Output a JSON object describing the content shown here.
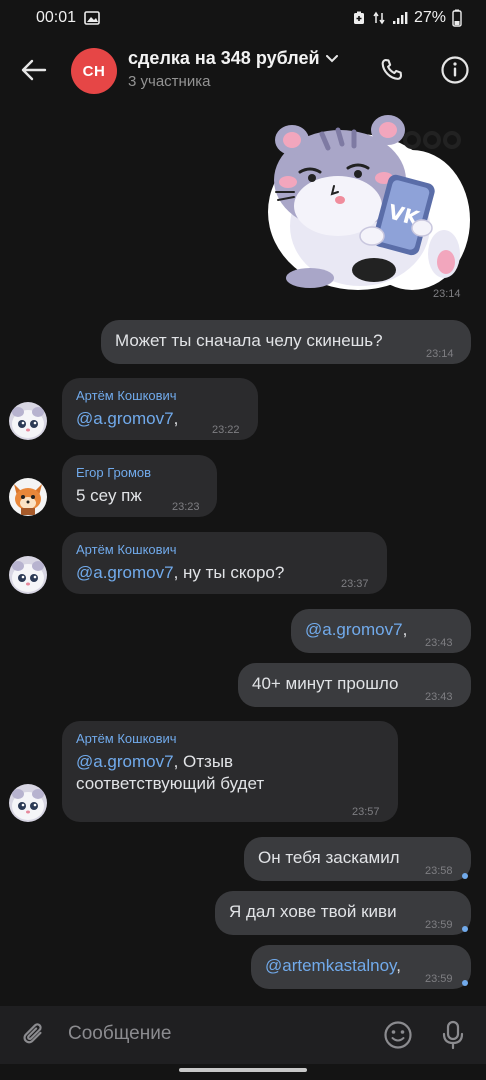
{
  "status_bar": {
    "time": "00:01",
    "battery": "27%"
  },
  "header": {
    "avatar_initials": "СН",
    "title": "сделка на 348 рублей",
    "subtitle": "3 участника",
    "colors": {
      "avatar": "#e64646",
      "accent": "#71aaeb"
    }
  },
  "sticker": {
    "time": "23:14"
  },
  "messages": [
    {
      "dir": "out",
      "text": "Может ты сначала челу скинешь?",
      "time": "23:14"
    },
    {
      "dir": "in",
      "sender": "Артём Кошкович",
      "mention": "@a.gromov7",
      "text": ",",
      "time": "23:22"
    },
    {
      "dir": "in",
      "sender": "Егор Громов",
      "text": "5 сеу пж",
      "time": "23:23"
    },
    {
      "dir": "in",
      "sender": "Артём Кошкович",
      "mention": "@a.gromov7",
      "text": ", ну ты скоро?",
      "time": "23:37"
    },
    {
      "dir": "out",
      "mention": "@a.gromov7",
      "text": ",",
      "time": "23:43"
    },
    {
      "dir": "out",
      "text": "40+ минут прошло",
      "time": "23:43"
    },
    {
      "dir": "in",
      "sender": "Артём Кошкович",
      "mention": "@a.gromov7",
      "text": ", Отзыв",
      "text2": "соответствующий будет",
      "time": "23:57"
    },
    {
      "dir": "out",
      "text": "Он тебя заскамил",
      "time": "23:58"
    },
    {
      "dir": "out",
      "text": "Я дал хове твой киви",
      "time": "23:59"
    },
    {
      "dir": "out",
      "mention": "@artemkastalnoy",
      "text": ",",
      "time": "23:59"
    }
  ],
  "composer": {
    "placeholder": "Сообщение"
  }
}
